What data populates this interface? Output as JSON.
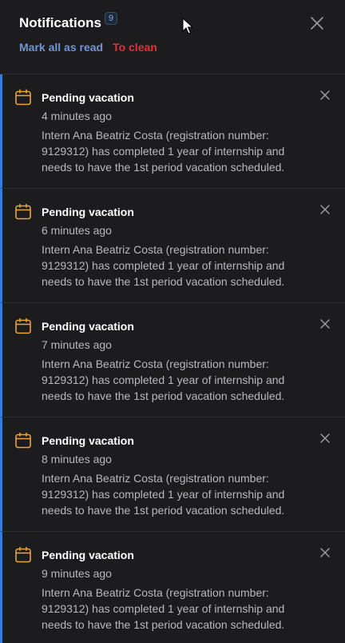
{
  "header": {
    "title": "Notifications",
    "unread_count": "9",
    "mark_all_read_label": "Mark all as read",
    "clean_label": "To clean",
    "close_icon": "close-icon"
  },
  "colors": {
    "background": "#1c1c1f",
    "accent_blue": "#6f96d3",
    "danger_red": "#e0323b",
    "icon_orange": "#e8a33a",
    "unread_bar": "#3a7bd5"
  },
  "notifications": [
    {
      "title": "Pending vacation",
      "time": "4 minutes ago",
      "body": "Intern Ana Beatriz Costa (registration number: 9129312) has completed 1 year of internship and needs to have the 1st period vacation scheduled.",
      "icon": "calendar-icon"
    },
    {
      "title": "Pending vacation",
      "time": "6 minutes ago",
      "body": "Intern Ana Beatriz Costa (registration number: 9129312) has completed 1 year of internship and needs to have the 1st period vacation scheduled.",
      "icon": "calendar-icon"
    },
    {
      "title": "Pending vacation",
      "time": "7 minutes ago",
      "body": "Intern Ana Beatriz Costa (registration number: 9129312) has completed 1 year of internship and needs to have the 1st period vacation scheduled.",
      "icon": "calendar-icon"
    },
    {
      "title": "Pending vacation",
      "time": "8 minutes ago",
      "body": "Intern Ana Beatriz Costa (registration number: 9129312) has completed 1 year of internship and needs to have the 1st period vacation scheduled.",
      "icon": "calendar-icon"
    },
    {
      "title": "Pending vacation",
      "time": "9 minutes ago",
      "body": "Intern Ana Beatriz Costa (registration number: 9129312) has completed 1 year of internship and needs to have the 1st period vacation scheduled.",
      "icon": "calendar-icon"
    }
  ]
}
